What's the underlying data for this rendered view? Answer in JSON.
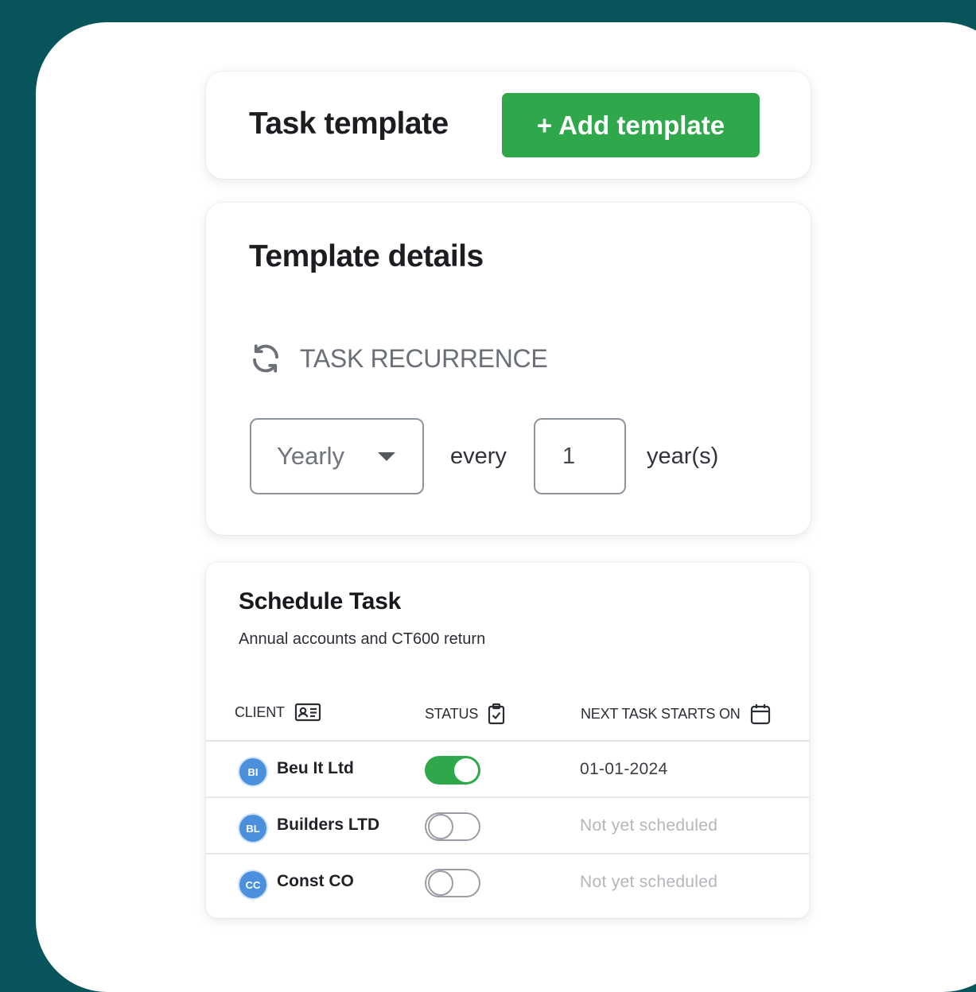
{
  "task_template": {
    "title": "Task template",
    "add_button": "+ Add template"
  },
  "template_details": {
    "title": "Template details",
    "recurrence_label": "TASK RECURRENCE",
    "frequency_select": "Yearly",
    "every_label": "every",
    "interval_value": "1",
    "unit_label": "year(s)"
  },
  "schedule": {
    "title": "Schedule Task",
    "subtitle": "Annual accounts and CT600 return",
    "columns": {
      "client": "CLIENT",
      "status": "STATUS",
      "next_task": "NEXT TASK STARTS ON"
    },
    "rows": [
      {
        "initials": "BI",
        "name": "Beu It Ltd",
        "enabled": true,
        "next": "01-01-2024"
      },
      {
        "initials": "BL",
        "name": "Builders LTD",
        "enabled": false,
        "next": "Not yet scheduled"
      },
      {
        "initials": "CC",
        "name": "Const CO",
        "enabled": false,
        "next": "Not yet scheduled"
      }
    ]
  },
  "colors": {
    "background": "#07545a",
    "accent_green": "#2ea84a",
    "avatar_blue": "#4a90dc"
  },
  "icons": [
    "refresh-icon",
    "chevron-down-icon",
    "id-card-icon",
    "clipboard-check-icon",
    "calendar-icon"
  ]
}
